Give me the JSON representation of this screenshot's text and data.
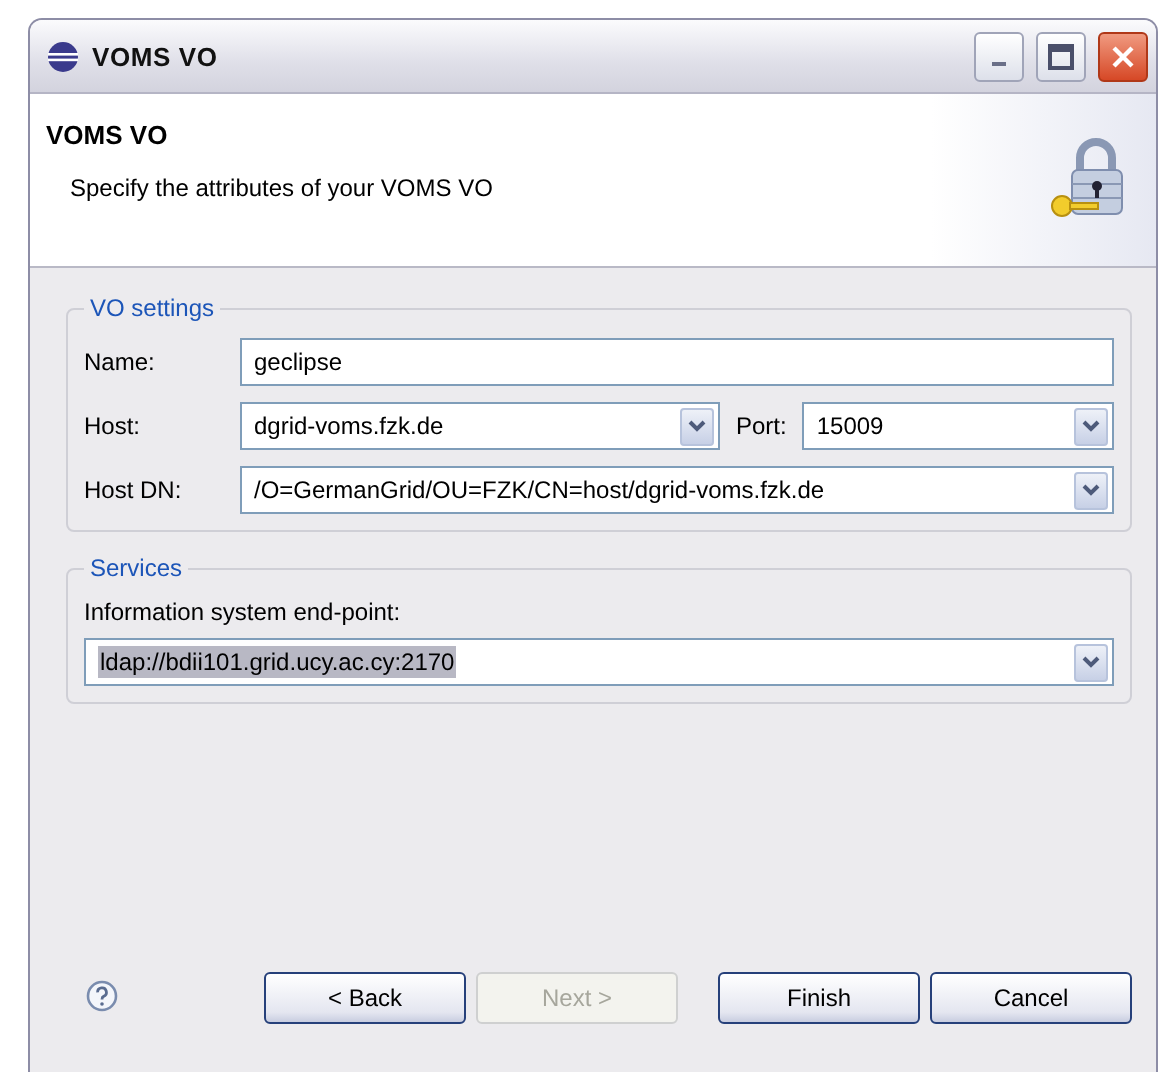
{
  "window": {
    "title": "VOMS VO"
  },
  "header": {
    "title": "VOMS VO",
    "description": "Specify the attributes of your VOMS VO"
  },
  "vo_settings": {
    "title": "VO settings",
    "rows": [
      {
        "label": "Name:",
        "kind": "text",
        "value": "geclipse"
      },
      {
        "label": "Host:",
        "kind": "combo",
        "value": "dgrid-voms.fzk.de",
        "extra": {
          "label": "Port:",
          "kind": "combo",
          "value": "15009"
        }
      },
      {
        "label": "Host DN:",
        "kind": "combo",
        "value": "/O=GermanGrid/OU=FZK/CN=host/dgrid-voms.fzk.de"
      }
    ]
  },
  "services": {
    "title": "Services",
    "label": "Information system end-point:",
    "field": {
      "kind": "combo",
      "value": "ldap://bdii101.grid.ucy.ac.cy:2170",
      "text_selected": true
    }
  },
  "buttons": [
    {
      "label": "< Back",
      "disabled": false
    },
    {
      "label": "Next >",
      "disabled": true
    },
    {
      "label": "Finish",
      "disabled": false
    },
    {
      "label": "Cancel",
      "disabled": false
    }
  ]
}
